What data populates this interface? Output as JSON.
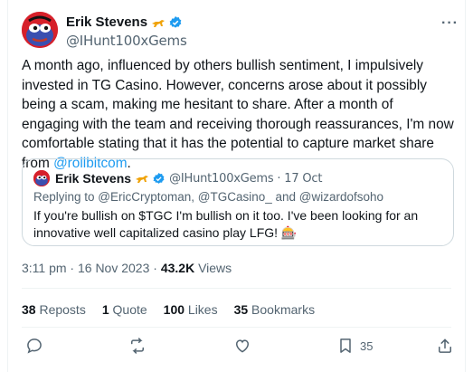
{
  "author": {
    "name": "Erik Stevens",
    "handle": "@IHunt100xGems"
  },
  "tweet": {
    "text_before_link": "A month ago, influenced by others bullish sentiment, I impulsively invested in TG Casino. However, concerns arose about it possibly being a scam, making me hesitant to share. After a month of engaging with the team and receiving thorough reassurances, I'm now comfortable stating that it has the potential to capture market share from ",
    "link": "@rollbitcom",
    "text_after_link": ".",
    "time": "3:11 pm · 16 Nov 2023 · ",
    "views_count": "43.2K",
    "views_label": " Views"
  },
  "quote": {
    "name": "Erik Stevens",
    "handle_date": "@IHunt100xGems · 17 Oct",
    "replying": "Replying to @EricCryptoman, @TGCasino_ and @wizardofsoho",
    "text": "If you're bullish on $TGC I'm bullish on it too. I've been looking for an innovative well capitalized casino play LFG! 🎰"
  },
  "stats": {
    "reposts_count": "38",
    "reposts_label": " Reposts",
    "quotes_count": "1",
    "quotes_label": " Quote",
    "likes_count": "100",
    "likes_label": " Likes",
    "bookmarks_count": "35",
    "bookmarks_label": " Bookmarks"
  },
  "actions": {
    "bookmark_count": "35"
  },
  "icons": [
    "pepe-avatar",
    "hunter-glyph",
    "verified-badge-icon",
    "more-icon",
    "reply-icon",
    "repost-icon",
    "like-icon",
    "bookmark-icon",
    "share-icon"
  ],
  "colors": {
    "text": "#0f1419",
    "secondary": "#536471",
    "link": "#1d9bf0",
    "border": "#cfd9de",
    "verified": "#1d9bf0"
  }
}
